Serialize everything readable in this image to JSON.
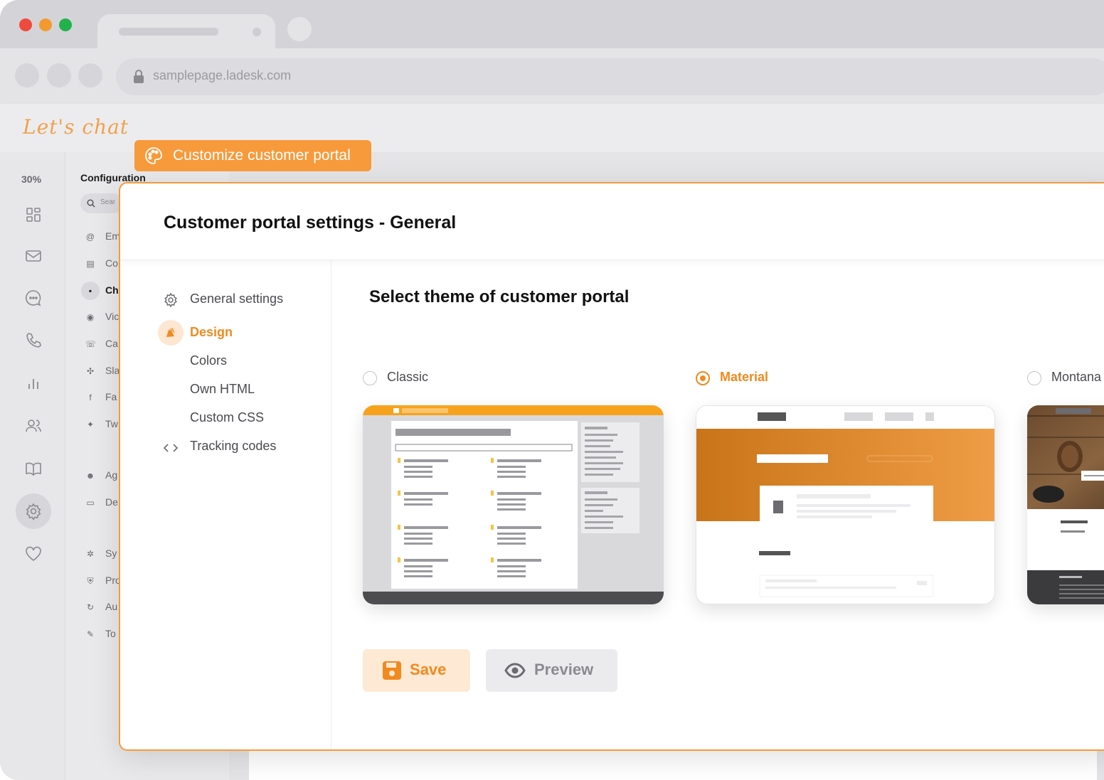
{
  "browser": {
    "url": "samplepage.ladesk.com"
  },
  "app": {
    "logo_text": "Let's chat",
    "usage_percent": "30%"
  },
  "config": {
    "title": "Configuration",
    "search_placeholder": "Sear",
    "items": [
      {
        "icon": "at-icon",
        "label": "Em"
      },
      {
        "icon": "form-icon",
        "label": "Co"
      },
      {
        "icon": "chat-icon",
        "label": "Ch"
      },
      {
        "icon": "video-icon",
        "label": "Vic"
      },
      {
        "icon": "phone-icon",
        "label": "Ca"
      },
      {
        "icon": "slack-icon",
        "label": "Sla"
      },
      {
        "icon": "facebook-icon",
        "label": "Fa"
      },
      {
        "icon": "twitter-icon",
        "label": "Tw"
      },
      {
        "icon": "agent-icon",
        "label": "Ag"
      },
      {
        "icon": "folder-icon",
        "label": "De"
      },
      {
        "icon": "system-icon",
        "label": "Sy"
      },
      {
        "icon": "shield-icon",
        "label": "Pro"
      },
      {
        "icon": "automation-icon",
        "label": "Au"
      },
      {
        "icon": "wrench-icon",
        "label": "To"
      }
    ]
  },
  "tag": {
    "label": "Customize customer portal"
  },
  "modal": {
    "title": "Customer portal settings - General",
    "nav": [
      {
        "icon": "gear-icon",
        "label": "General settings"
      },
      {
        "icon": "design-icon",
        "label": "Design",
        "active": true
      },
      {
        "label": "Colors"
      },
      {
        "label": "Own HTML"
      },
      {
        "label": "Custom CSS"
      },
      {
        "icon": "code-icon",
        "label": "Tracking codes"
      }
    ],
    "section_title": "Select theme of customer portal",
    "themes": [
      {
        "label": "Classic",
        "selected": false
      },
      {
        "label": "Material",
        "selected": true
      },
      {
        "label": "Montana",
        "selected": false
      }
    ],
    "save_label": "Save",
    "preview_label": "Preview"
  },
  "colors": {
    "accent": "#f79a3b",
    "accent_text": "#f08a1e"
  }
}
